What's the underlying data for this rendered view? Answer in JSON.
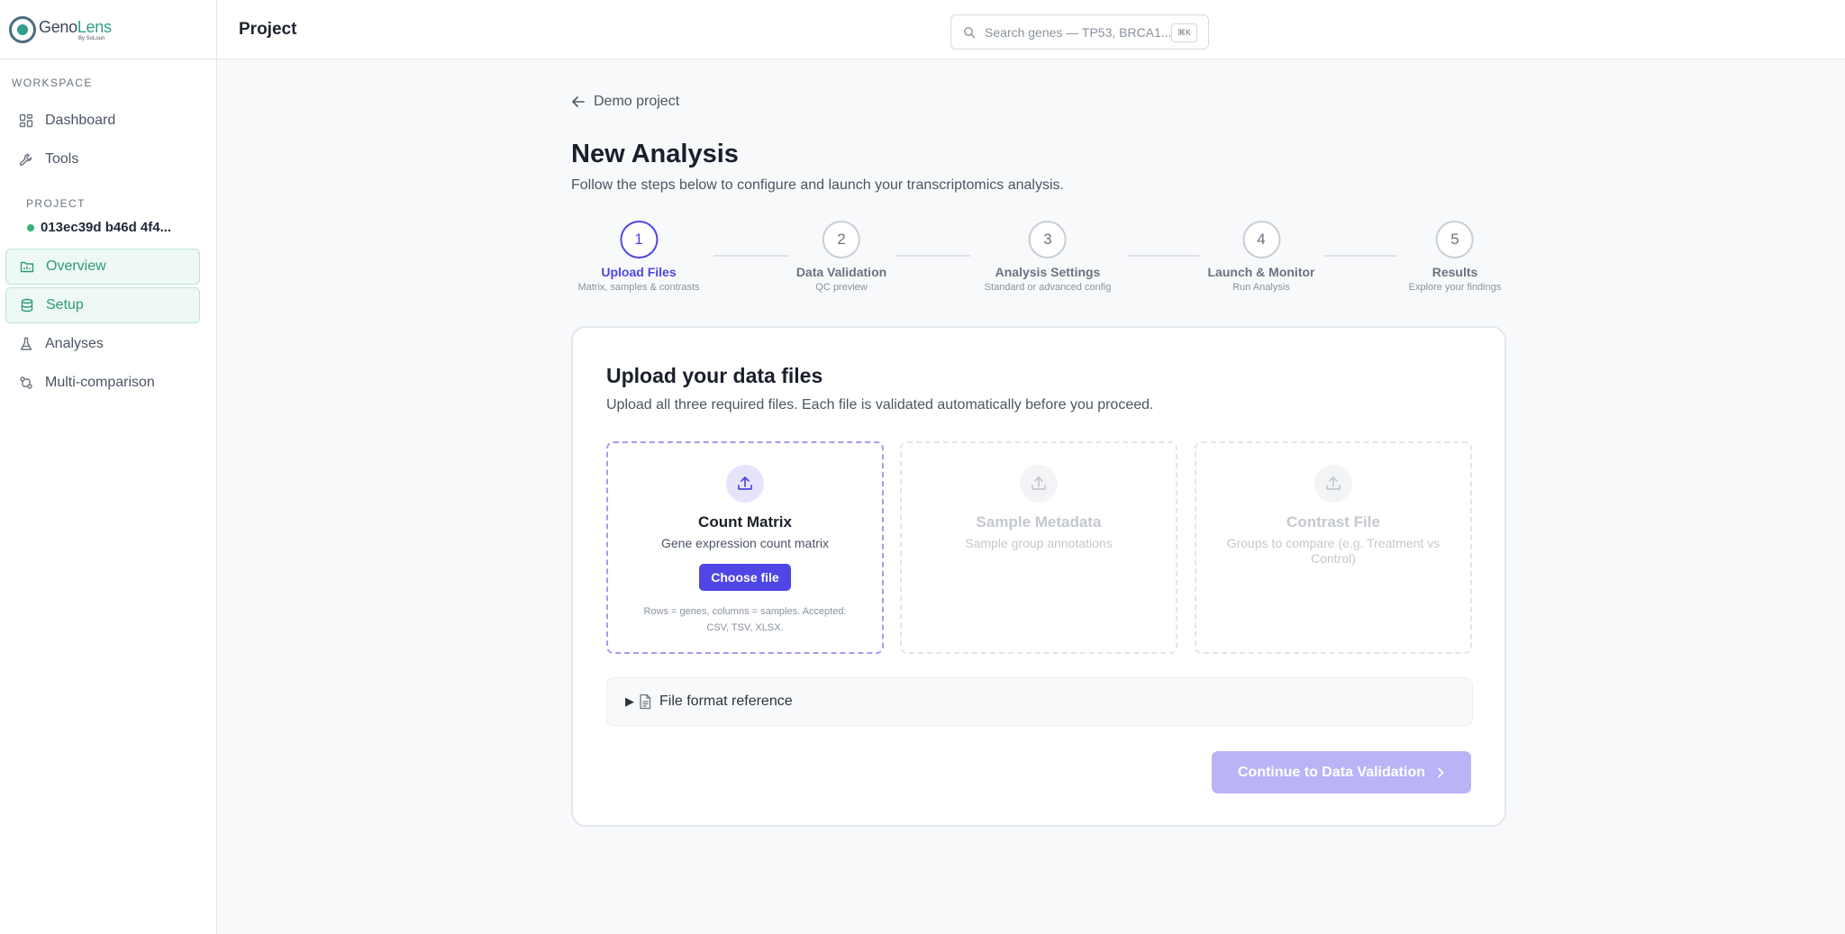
{
  "app": {
    "logo_text_a": "Geno",
    "logo_text_b": "Lens",
    "logo_sub": "By SoLoun"
  },
  "topbar": {
    "title": "Project",
    "search_placeholder": "Search genes — TP53, BRCA1...",
    "search_shortcut": "⌘K"
  },
  "sidebar": {
    "workspace_label": "WORKSPACE",
    "workspace_items": [
      {
        "label": "Dashboard",
        "icon": "grid-icon"
      },
      {
        "label": "Tools",
        "icon": "wrench-icon"
      }
    ],
    "project_label": "PROJECT",
    "project_id": "013ec39d b46d 4f4...",
    "project_status_color": "#34b27b",
    "project_items": [
      {
        "label": "Overview",
        "icon": "folder-chart-icon",
        "active": true
      },
      {
        "label": "Setup",
        "icon": "database-icon",
        "active": true
      },
      {
        "label": "Analyses",
        "icon": "flask-icon",
        "active": false
      },
      {
        "label": "Multi-comparison",
        "icon": "compare-icon",
        "active": false
      }
    ]
  },
  "main": {
    "back_label": "Demo project",
    "title": "New Analysis",
    "subtitle": "Follow the steps below to configure and launch your transcriptomics analysis.",
    "accent_color": "#4f46e5",
    "steps": [
      {
        "number": "1",
        "label": "Upload Files",
        "desc": "Matrix, samples & contrasts",
        "current": true
      },
      {
        "number": "2",
        "label": "Data Validation",
        "desc": "QC preview",
        "current": false
      },
      {
        "number": "3",
        "label": "Analysis Settings",
        "desc": "Standard or advanced config",
        "current": false
      },
      {
        "number": "4",
        "label": "Launch & Monitor",
        "desc": "Run Analysis",
        "current": false
      },
      {
        "number": "5",
        "label": "Results",
        "desc": "Explore your findings",
        "current": false
      }
    ],
    "card": {
      "title": "Upload your data files",
      "subtitle": "Upload all three required files. Each file is validated automatically before you proceed.",
      "uploads": [
        {
          "title": "Count Matrix",
          "desc": "Gene expression count matrix",
          "button": "Choose file",
          "note": "Rows = genes, columns = samples. Accepted: CSV, TSV, XLSX.",
          "enabled": true
        },
        {
          "title": "Sample Metadata",
          "desc": "Sample group annotations",
          "enabled": false
        },
        {
          "title": "Contrast File",
          "desc": "Groups to compare (e.g. Treatment vs Control)",
          "enabled": false
        }
      ],
      "format_reference": "File format reference",
      "continue_label": "Continue to Data Validation"
    }
  }
}
